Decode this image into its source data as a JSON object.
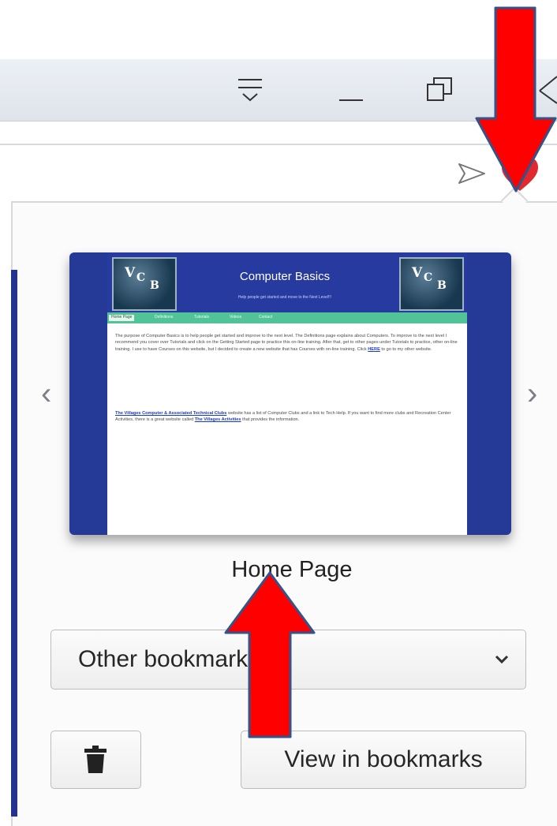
{
  "window_controls": {
    "tab_list": "tab-list-icon",
    "minimize": "minimize-icon",
    "restore": "restore-icon",
    "close": "close-icon"
  },
  "toolbar": {
    "send_icon": "send-icon",
    "bookmark_icon": "heart-icon",
    "bookmark_color": "#e0282e"
  },
  "panel": {
    "prev_arrow": "‹",
    "next_arrow": "›",
    "thumbnail": {
      "logo_letters": [
        "V",
        "C",
        "B"
      ],
      "title": "Computer Basics",
      "subtitle": "Help people get started and move to the Next Level!!!",
      "nav_tabs": [
        "Home Page",
        "Definitions",
        "Tutorials",
        "Videos",
        "Contact"
      ],
      "paragraph1": "The purpose of Computer Basics is to help people get started and improve to the next level. The Definitions page explains about Computers. To improve to the next level I recommend you cover over Tutorials and click on the Getting Started page to practice this on-line training. After that, get to other pages under Tutorials to practice, other on-line training. I use to have Courses on this website, but I decided to create a new website that has Courses with on-line training. Click",
      "paragraph1_link": "HERE",
      "paragraph1_end": "to go to my other website.",
      "paragraph2_link": "The Villages Computer & Associated Technical Clubs",
      "paragraph2": "website has a list of Computer Clubs and a link to Tech Help. If you want to find more clubs and Recreation Center Activities, there is a great website called",
      "paragraph2_link2": "The Villages Activities",
      "paragraph2_end": "that provides the information.",
      "brand_color": "#253a97",
      "nav_color": "#52c298"
    },
    "bookmark_name": "Home Page",
    "folder_value": "Other bookmarks",
    "remove_icon": "trash-icon",
    "view_button": "View in bookmarks"
  },
  "annotations": {
    "arrow_color": "#ff0000"
  }
}
